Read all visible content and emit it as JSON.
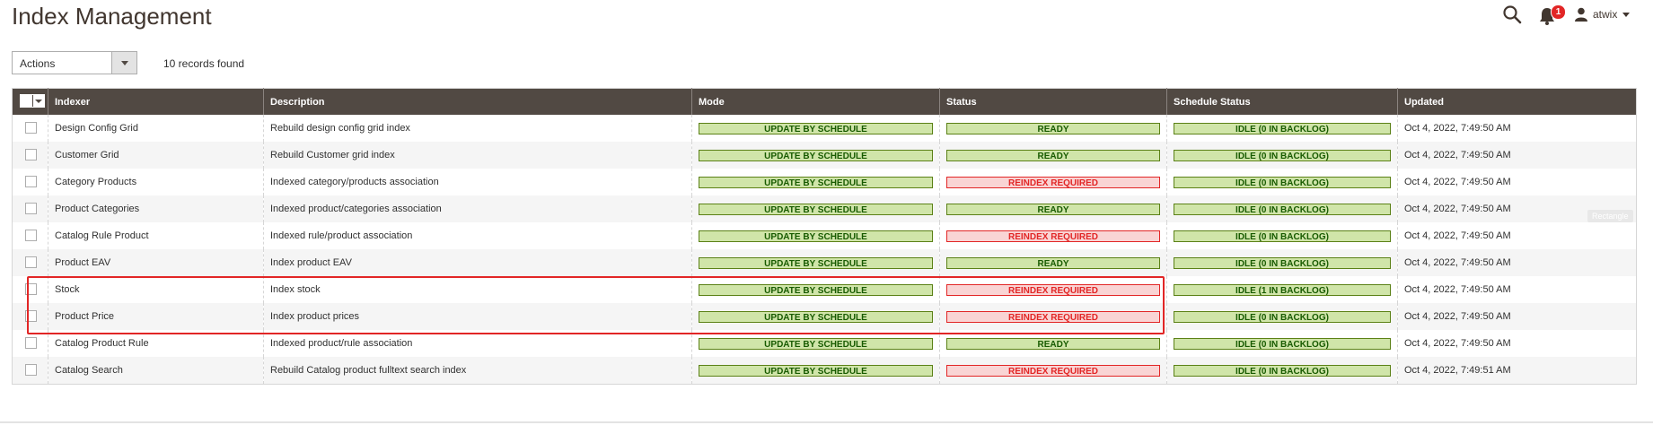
{
  "header": {
    "title": "Index Management",
    "notifications_count": "1",
    "user_name": "atwix"
  },
  "toolbar": {
    "actions_label": "Actions",
    "records_found": "10 records found"
  },
  "grid": {
    "columns": [
      "Indexer",
      "Description",
      "Mode",
      "Status",
      "Schedule Status",
      "Updated"
    ],
    "rows": [
      {
        "indexer": "Design Config Grid",
        "description": "Rebuild design config grid index",
        "mode": "UPDATE BY SCHEDULE",
        "status": "READY",
        "status_type": "ok",
        "schedule": "IDLE (0 IN BACKLOG)",
        "updated": "Oct 4, 2022, 7:49:50 AM"
      },
      {
        "indexer": "Customer Grid",
        "description": "Rebuild Customer grid index",
        "mode": "UPDATE BY SCHEDULE",
        "status": "READY",
        "status_type": "ok",
        "schedule": "IDLE (0 IN BACKLOG)",
        "updated": "Oct 4, 2022, 7:49:50 AM"
      },
      {
        "indexer": "Category Products",
        "description": "Indexed category/products association",
        "mode": "UPDATE BY SCHEDULE",
        "status": "REINDEX REQUIRED",
        "status_type": "bad",
        "schedule": "IDLE (0 IN BACKLOG)",
        "updated": "Oct 4, 2022, 7:49:50 AM"
      },
      {
        "indexer": "Product Categories",
        "description": "Indexed product/categories association",
        "mode": "UPDATE BY SCHEDULE",
        "status": "READY",
        "status_type": "ok",
        "schedule": "IDLE (0 IN BACKLOG)",
        "updated": "Oct 4, 2022, 7:49:50 AM"
      },
      {
        "indexer": "Catalog Rule Product",
        "description": "Indexed rule/product association",
        "mode": "UPDATE BY SCHEDULE",
        "status": "REINDEX REQUIRED",
        "status_type": "bad",
        "schedule": "IDLE (0 IN BACKLOG)",
        "updated": "Oct 4, 2022, 7:49:50 AM"
      },
      {
        "indexer": "Product EAV",
        "description": "Index product EAV",
        "mode": "UPDATE BY SCHEDULE",
        "status": "READY",
        "status_type": "ok",
        "schedule": "IDLE (0 IN BACKLOG)",
        "updated": "Oct 4, 2022, 7:49:50 AM"
      },
      {
        "indexer": "Stock",
        "description": "Index stock",
        "mode": "UPDATE BY SCHEDULE",
        "status": "REINDEX REQUIRED",
        "status_type": "bad",
        "schedule": "IDLE (1 IN BACKLOG)",
        "updated": "Oct 4, 2022, 7:49:50 AM"
      },
      {
        "indexer": "Product Price",
        "description": "Index product prices",
        "mode": "UPDATE BY SCHEDULE",
        "status": "REINDEX REQUIRED",
        "status_type": "bad",
        "schedule": "IDLE (0 IN BACKLOG)",
        "updated": "Oct 4, 2022, 7:49:50 AM"
      },
      {
        "indexer": "Catalog Product Rule",
        "description": "Indexed product/rule association",
        "mode": "UPDATE BY SCHEDULE",
        "status": "READY",
        "status_type": "ok",
        "schedule": "IDLE (0 IN BACKLOG)",
        "updated": "Oct 4, 2022, 7:49:50 AM"
      },
      {
        "indexer": "Catalog Search",
        "description": "Rebuild Catalog product fulltext search index",
        "mode": "UPDATE BY SCHEDULE",
        "status": "REINDEX REQUIRED",
        "status_type": "bad",
        "schedule": "IDLE (0 IN BACKLOG)",
        "updated": "Oct 4, 2022, 7:49:51 AM"
      }
    ]
  },
  "annotation": {
    "tag_label": "Rectangle"
  },
  "colors": {
    "header_bg": "#514943",
    "ok_bg": "#d0e5a9",
    "ok_text": "#185b00",
    "bad_bg": "#f9d4d4",
    "bad_text": "#e22626",
    "highlight": "#e22626"
  }
}
